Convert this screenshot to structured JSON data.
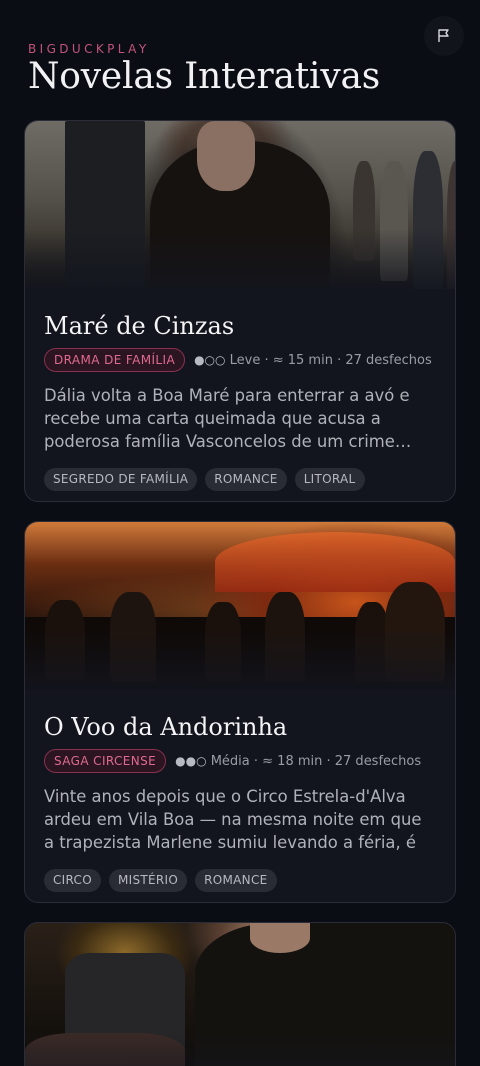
{
  "header": {
    "brand": "BIGDUCKPLAY",
    "title": "Novelas Interativas",
    "flag_icon": "flag-icon"
  },
  "stories": [
    {
      "title": "Maré de Cinzas",
      "genre": "DRAMA DE FAMÍLIA",
      "difficulty_dots": "●○○",
      "meta": " Leve · ≈ 15 min · 27 desfechos",
      "synopsis": "Dália volta a Boa Maré para enterrar a avó e recebe uma carta queimada que acusa a poderosa família Vasconcelos de um crime…",
      "tags": [
        "SEGREDO DE FAMÍLIA",
        "ROMANCE",
        "LITORAL"
      ],
      "image": "woman-at-seaside-promenade"
    },
    {
      "title": "O Voo da Andorinha",
      "genre": "SAGA CIRCENSE",
      "difficulty_dots": "●●○",
      "meta": " Média · ≈ 18 min · 27 desfechos",
      "synopsis": "Vinte anos depois que o Circo Estrela-d'Alva ardeu em Vila Boa — na mesma noite em que a trapezista Marlene sumiu levando a féria, é o…",
      "tags": [
        "CIRCO",
        "MISTÉRIO",
        "ROMANCE"
      ],
      "image": "crowd-at-circus-tent-dusk"
    },
    {
      "title": "",
      "genre": "",
      "image": "woman-with-microscope"
    }
  ],
  "colors": {
    "background": "#0b0d14",
    "accent": "#e06a8f",
    "card": "#13151e"
  }
}
